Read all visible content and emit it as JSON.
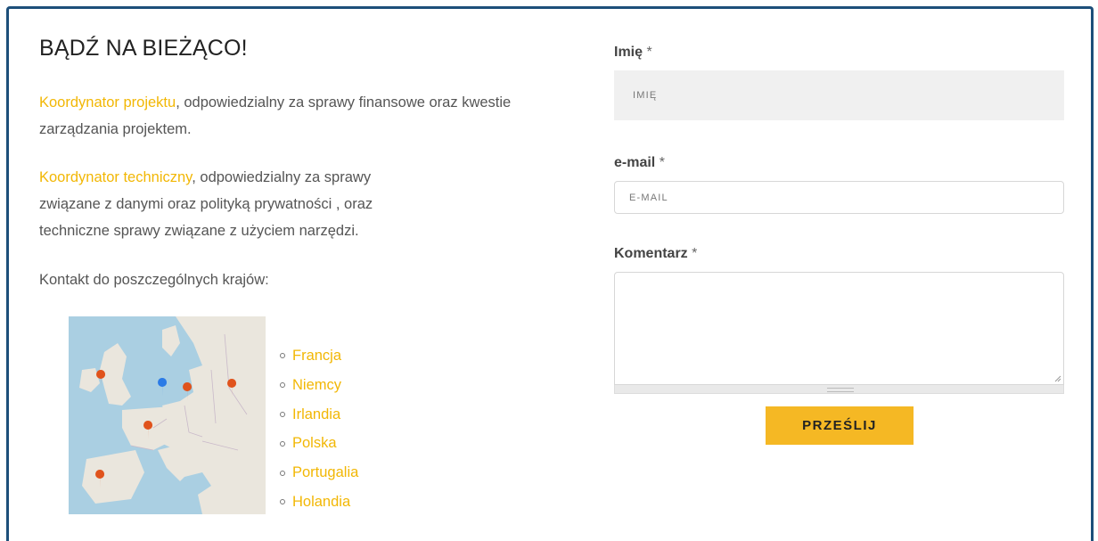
{
  "heading": "BĄDŹ NA BIEŻĄCO!",
  "para1": {
    "link": "Koordynator projektu",
    "rest": ", odpowiedzialny za sprawy finansowe oraz kwestie zarządzania projektem."
  },
  "para2": {
    "link": "Koordynator techniczny",
    "rest": ", odpowiedzialny za sprawy związane z danymi oraz polityką prywatności , oraz techniczne sprawy związane z użyciem narzędzi."
  },
  "countries_label": "Kontakt do poszczególnych krajów:",
  "countries": [
    "Francja",
    "Niemcy",
    "Irlandia",
    "Polska",
    "Portugalia",
    "Holandia"
  ],
  "form": {
    "name_label": "Imię",
    "name_placeholder": "IMIĘ",
    "email_label": "e-mail",
    "email_placeholder": "E-MAIL",
    "comment_label": "Komentarz",
    "required_mark": "*",
    "submit_label": "PRZEŚLIJ"
  },
  "colors": {
    "accent": "#f2b705",
    "button": "#f5b824",
    "frame": "#1d4f7a"
  },
  "map_icon": "europe-map-with-pins"
}
